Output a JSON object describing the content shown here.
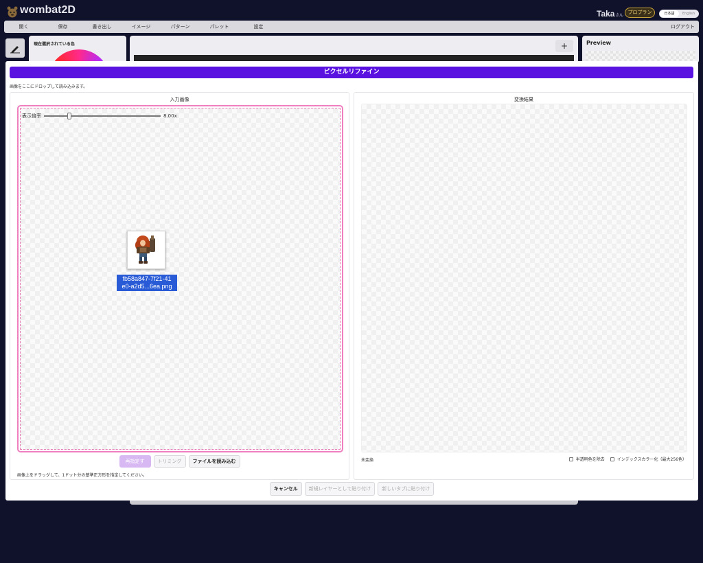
{
  "app": {
    "name": "wombat2D",
    "user_name": "Taka",
    "user_suffix": "さん",
    "plan": "プロプラン",
    "languages": [
      "日本語",
      "English"
    ]
  },
  "menu": {
    "items": [
      "開く",
      "保存",
      "書き出し",
      "イメージ",
      "パターン",
      "パレット",
      "設定"
    ],
    "logout": "ログアウト"
  },
  "background": {
    "color_panel_title": "現在選択されている色",
    "plus": "+",
    "preview_title": "Preview"
  },
  "modal": {
    "title": "ピクセルリファイン",
    "hint": "画像をここにドロップして読み込みます。",
    "input": {
      "title": "入力画像",
      "zoom_label": "表示倍率",
      "zoom_value": "8.00x",
      "zoom_fraction": 0.2,
      "file_name_line1": "fb58a847-7f21-41",
      "file_name_line2": "e0-a2d5...6ea.png",
      "buttons": {
        "respecify": "再指定する",
        "trim": "トリミング",
        "load_file": "ファイルを読み込む"
      },
      "footer": "画像上をドラッグして、1ドット分の基準正方形を指定してください。"
    },
    "result": {
      "title": "変換結果",
      "status": "未変換",
      "options": {
        "remove_translucent": "半透明色を除去",
        "index_color": "インデックスカラー化（最大256色）"
      }
    },
    "footer_buttons": {
      "cancel": "キャンセル",
      "paste_new_layer": "新規レイヤーとして貼り付け",
      "paste_new_tab": "新しいタブに貼り付け"
    }
  }
}
